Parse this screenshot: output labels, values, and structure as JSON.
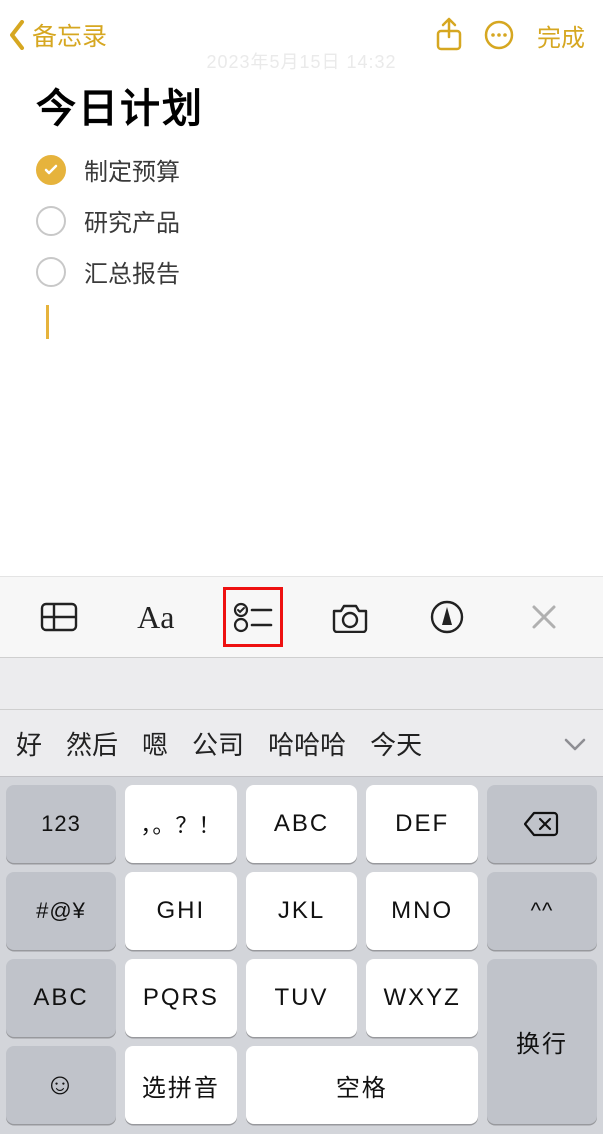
{
  "nav": {
    "back_label": "备忘录",
    "done_label": "完成"
  },
  "timestamp": "2023年5月15日 14:32",
  "note": {
    "title": "今日计划",
    "items": [
      {
        "text": "制定预算",
        "done": true
      },
      {
        "text": "研究产品",
        "done": false
      },
      {
        "text": "汇总报告",
        "done": false
      }
    ]
  },
  "toolbar": {
    "aa_label": "Aa"
  },
  "suggestions": [
    "好",
    "然后",
    "嗯",
    "公司",
    "哈哈哈",
    "今天"
  ],
  "keys": {
    "r1": [
      "123",
      "，。？！",
      "ABC",
      "DEF"
    ],
    "r2": [
      "#@¥",
      "GHI",
      "JKL",
      "MNO",
      "^^"
    ],
    "r3": [
      "ABC",
      "PQRS",
      "TUV",
      "WXYZ"
    ],
    "r4": {
      "emoji": "☺",
      "pinyin": "选拼音",
      "space": "空格",
      "return": "换行"
    }
  }
}
